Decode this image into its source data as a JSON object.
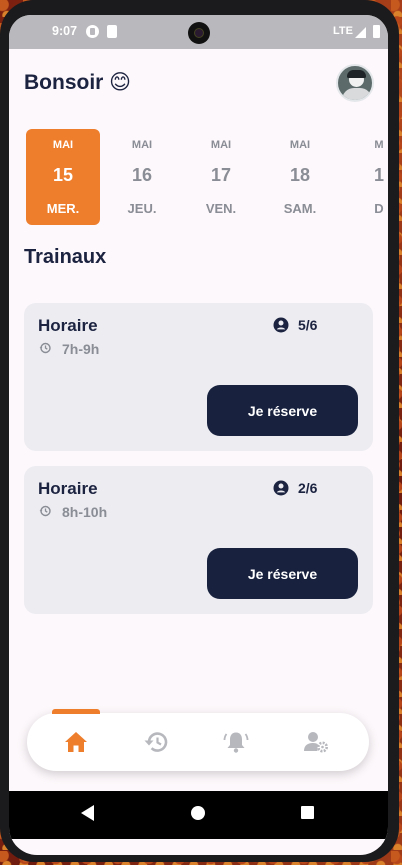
{
  "status_bar": {
    "time": "9:07",
    "network": "LTE"
  },
  "header": {
    "greeting": "Bonsoir 😊"
  },
  "days": [
    {
      "month": "MAI",
      "day": "15",
      "weekday": "MER.",
      "selected": true
    },
    {
      "month": "MAI",
      "day": "16",
      "weekday": "JEU.",
      "selected": false
    },
    {
      "month": "MAI",
      "day": "17",
      "weekday": "VEN.",
      "selected": false
    },
    {
      "month": "MAI",
      "day": "18",
      "weekday": "SAM.",
      "selected": false
    },
    {
      "month": "M",
      "day": "1",
      "weekday": "D",
      "selected": false
    }
  ],
  "section": {
    "title": "Trainaux"
  },
  "slots": [
    {
      "label": "Horaire",
      "time": "7h-9h",
      "capacity": "5/6",
      "button": "Je réserve"
    },
    {
      "label": "Horaire",
      "time": "8h-10h",
      "capacity": "2/6",
      "button": "Je réserve"
    }
  ],
  "bottom_nav": {
    "items": [
      "home-icon",
      "history-icon",
      "bell-icon",
      "user-settings-icon"
    ],
    "active": 0
  },
  "colors": {
    "accent": "#ee7d2c",
    "primary": "#18223f",
    "card": "#ececf1",
    "muted": "#8a8d95"
  }
}
